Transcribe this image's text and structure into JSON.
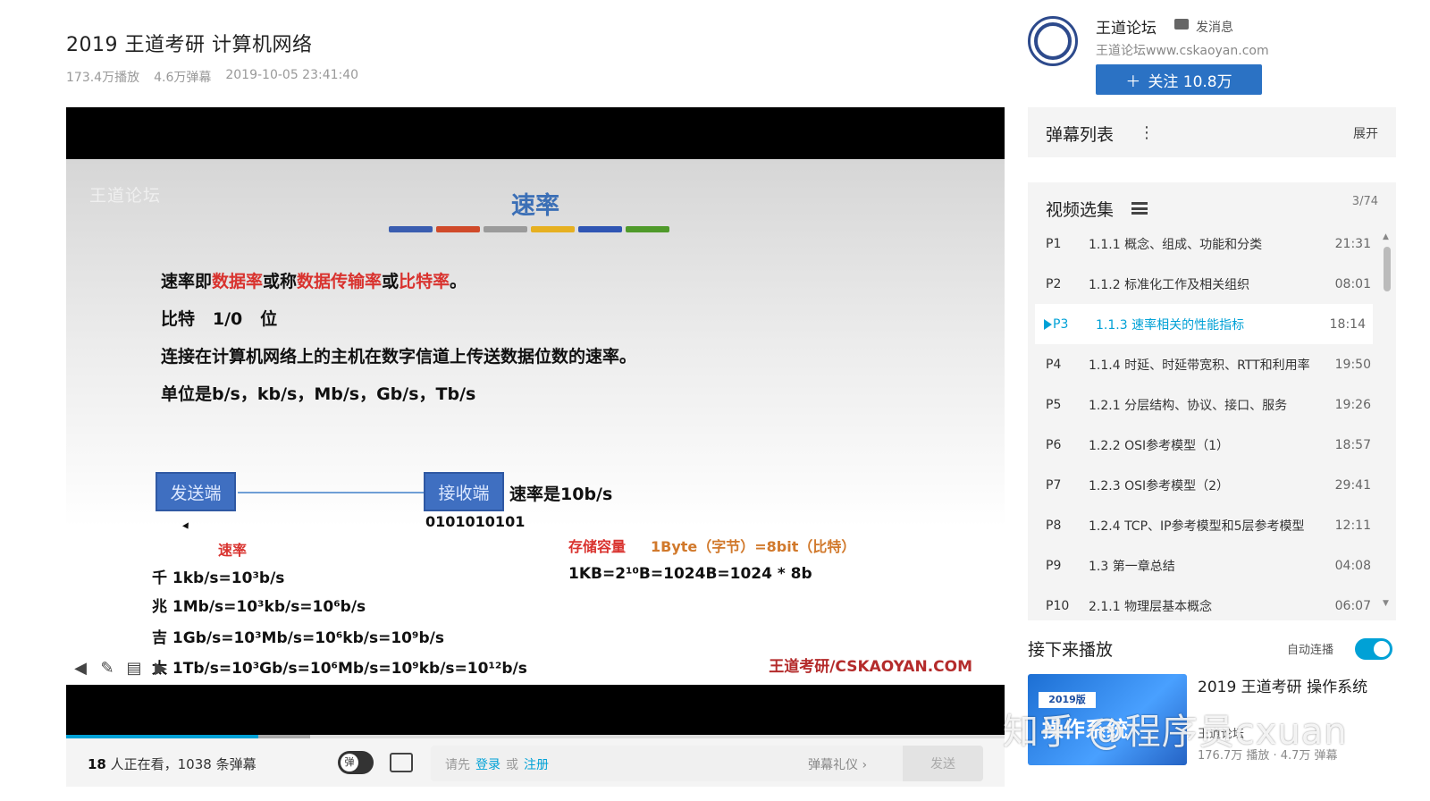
{
  "video": {
    "title": "2019 王道考研 计算机网络",
    "plays": "173.4万播放",
    "danmaku_count": "4.6万弹幕",
    "datetime": "2019-10-05 23:41:40"
  },
  "progress": {
    "played_fraction": 0.205,
    "buffered_fraction": 0.26
  },
  "slide": {
    "watermark": "王道论坛",
    "title": "速率",
    "bar_colors": [
      "#3a5db0",
      "#d04a2a",
      "#9b9b9b",
      "#e6b021",
      "#2f55b3",
      "#4f9a2a"
    ],
    "line1": {
      "a": "速率即",
      "b": "数据率",
      "c": "或称",
      "d": "数据传输率",
      "e": "或",
      "f": "比特率",
      "g": "。"
    },
    "line2": "比特   1/0   位",
    "line3": "连接在计算机网络上的主机在数字信道上传送数据位数的速率。",
    "line4": "单位是b/s，kb/s，Mb/s，Gb/s，Tb/s",
    "sender": "发送端",
    "receiver": "接收端",
    "rate_note": "速率是10b/s",
    "bits": "0101010101",
    "rate_heading": "速率",
    "rate_lines": [
      "千 1kb/s=10³b/s",
      "兆 1Mb/s=10³kb/s=10⁶b/s",
      "吉 1Gb/s=10³Mb/s=10⁶kb/s=10⁹b/s",
      "太 1Tb/s=10³Gb/s=10⁶Mb/s=10⁹kb/s=10¹²b/s"
    ],
    "storage_heading": "存储容量",
    "storage_def": "1Byte（字节）=8bit（比特）",
    "storage_eq": "1KB=2¹⁰B=1024B=1024 * 8b",
    "footer": "王道考研/CSKAOYAN.COM"
  },
  "player_bar": {
    "viewers_num": "18",
    "viewers_text": " 人正在看，1038 条弹幕",
    "input_prefix": "请先",
    "login": "登录",
    "or": "或",
    "register": "注册",
    "etiquette": "弹幕礼仪 ›",
    "send": "发送"
  },
  "uploader": {
    "name": "王道论坛",
    "message": "发消息",
    "desc": "王道论坛www.cskaoyan.com",
    "follow": "关注 10.8万"
  },
  "danmaku_list": {
    "title": "弹幕列表",
    "kebab": "⋮",
    "expand": "展开"
  },
  "playlist": {
    "title": "视频选集",
    "count": "3/74",
    "episodes": [
      {
        "no": "P1",
        "title": "1.1.1 概念、组成、功能和分类",
        "dur": "21:31"
      },
      {
        "no": "P2",
        "title": "1.1.2 标准化工作及相关组织",
        "dur": "08:01"
      },
      {
        "no": "P3",
        "title": "1.1.3 速率相关的性能指标",
        "dur": "18:14"
      },
      {
        "no": "P4",
        "title": "1.1.4 时延、时延带宽积、RTT和利用率",
        "dur": "19:50"
      },
      {
        "no": "P5",
        "title": "1.2.1 分层结构、协议、接口、服务",
        "dur": "19:26"
      },
      {
        "no": "P6",
        "title": "1.2.2 OSI参考模型（1）",
        "dur": "18:57"
      },
      {
        "no": "P7",
        "title": "1.2.3 OSI参考模型（2）",
        "dur": "29:41"
      },
      {
        "no": "P8",
        "title": "1.2.4 TCP、IP参考模型和5层参考模型",
        "dur": "12:11"
      },
      {
        "no": "P9",
        "title": "1.3 第一章总结",
        "dur": "04:08"
      },
      {
        "no": "P10",
        "title": "2.1.1 物理层基本概念",
        "dur": "06:07"
      }
    ]
  },
  "next_up": {
    "heading": "接下来播放",
    "autoplay": "自动连播",
    "title": "2019 王道考研 操作系统",
    "thumb_badge": "2019版",
    "thumb_big": "操作系统",
    "uploader": "王道论坛",
    "stats": "176.7万 播放 · 4.7万 弹幕"
  },
  "watermark": "知乎 @程序员cxuan"
}
